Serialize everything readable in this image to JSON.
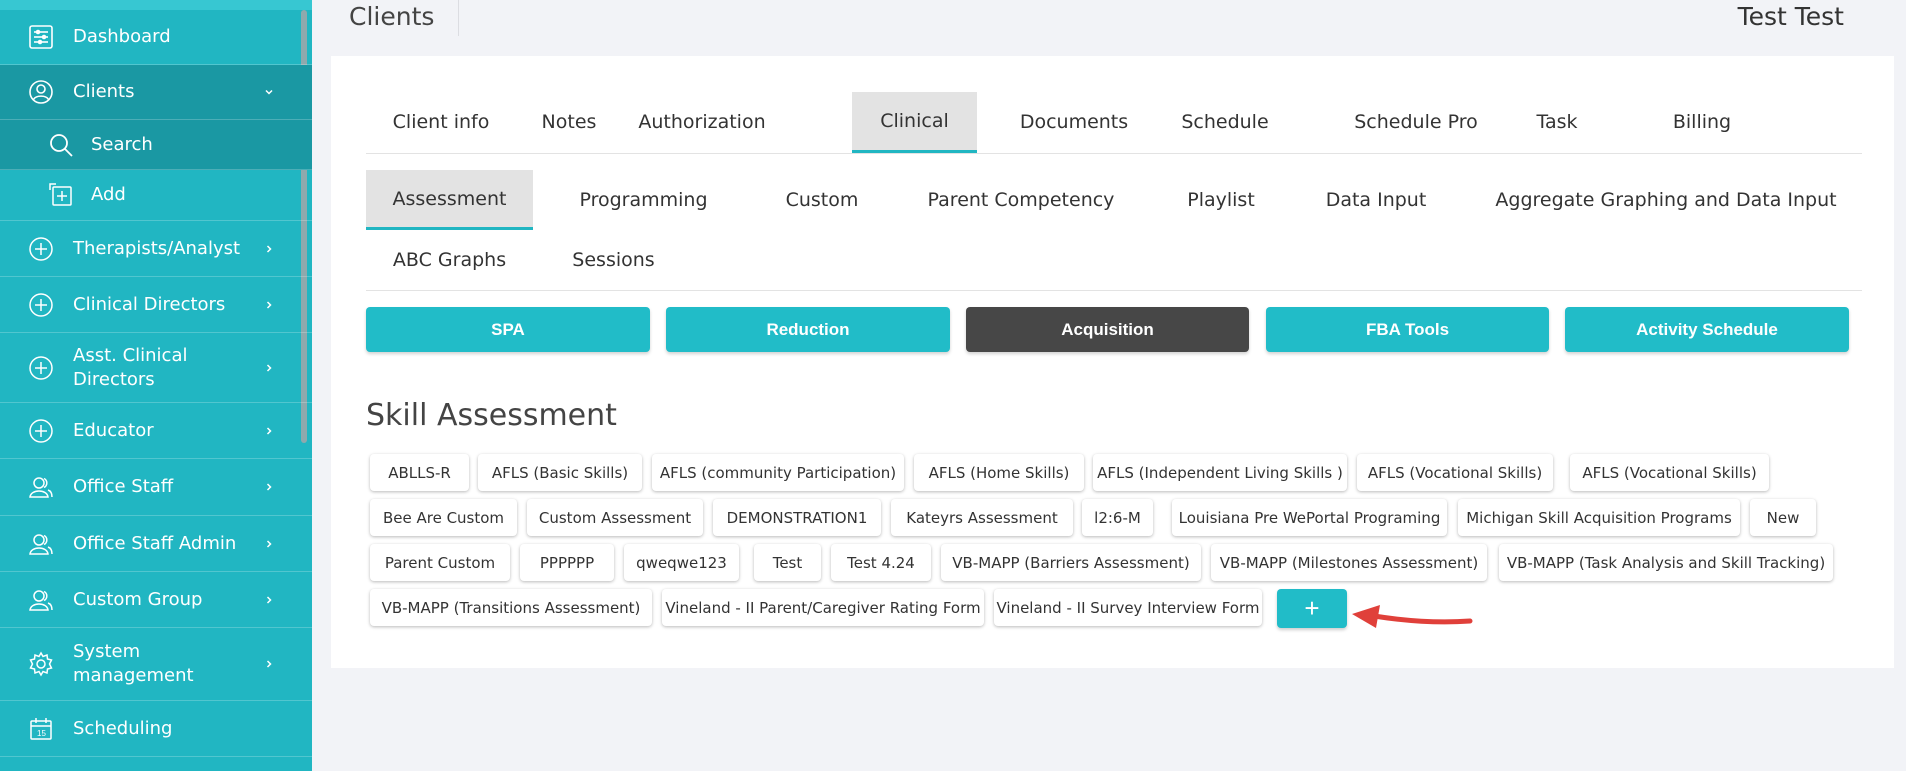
{
  "sidebar": {
    "items": [
      {
        "label": "Dashboard",
        "icon": "dashboard-icon"
      },
      {
        "label": "Clients",
        "icon": "user-circle-icon"
      },
      {
        "label": "Search",
        "icon": "search-icon"
      },
      {
        "label": "Add",
        "icon": "add-box-icon"
      },
      {
        "label": "Therapists/Analyst",
        "icon": "plus-circle-icon"
      },
      {
        "label": "Clinical Directors",
        "icon": "plus-circle-icon"
      },
      {
        "label": "Asst. Clinical Directors",
        "icon": "plus-circle-icon"
      },
      {
        "label": "Educator",
        "icon": "plus-circle-icon"
      },
      {
        "label": "Office Staff",
        "icon": "users-icon"
      },
      {
        "label": "Office Staff Admin",
        "icon": "users-icon"
      },
      {
        "label": "Custom Group",
        "icon": "users-icon"
      },
      {
        "label": "System management",
        "icon": "gear-icon"
      },
      {
        "label": "Scheduling",
        "icon": "calendar-icon"
      }
    ]
  },
  "header": {
    "title": "Clients",
    "user": "Test Test"
  },
  "tabs_primary": [
    "Client info",
    "Notes",
    "Authorization",
    "Clinical",
    "Documents",
    "Schedule",
    "Schedule Pro",
    "Task",
    "Billing"
  ],
  "tabs_primary_active": "Clinical",
  "tabs_secondary": [
    "Assessment",
    "Programming",
    "Custom",
    "Parent Competency",
    "Playlist",
    "Data Input",
    "Aggregate Graphing and Data Input",
    "ABC Graphs",
    "Sessions"
  ],
  "tabs_secondary_active": "Assessment",
  "type_buttons": [
    "SPA",
    "Reduction",
    "Acquisition",
    "FBA Tools",
    "Activity Schedule"
  ],
  "type_buttons_active": "Acquisition",
  "section_title": "Skill Assessment",
  "assessments": [
    "ABLLS-R",
    "AFLS (Basic Skills)",
    "AFLS (community Participation)",
    "AFLS (Home Skills)",
    "AFLS (Independent Living Skills )",
    "AFLS (Vocational Skills)",
    "AFLS (Vocational Skills)",
    "Bee Are Custom",
    "Custom Assessment",
    "DEMONSTRATION1",
    "Kateyrs Assessment",
    "l2:6-M",
    "Louisiana Pre WePortal Programing",
    "Michigan Skill Acquisition Programs",
    "New",
    "Parent Custom",
    "PPPPPP",
    "qweqwe123",
    "Test",
    "Test 4.24",
    "VB-MAPP (Barriers Assessment)",
    "VB-MAPP (Milestones Assessment)",
    "VB-MAPP (Task Analysis and Skill Tracking)",
    "VB-MAPP (Transitions Assessment)",
    "Vineland - II Parent/Caregiver Rating Form",
    "Vineland - II Survey Interview Form"
  ],
  "add_label": "+",
  "colors": {
    "accent": "#21b6c2",
    "sidebar_dark": "#1a98a3",
    "active_button": "#474747",
    "arrow": "#e0403a"
  }
}
